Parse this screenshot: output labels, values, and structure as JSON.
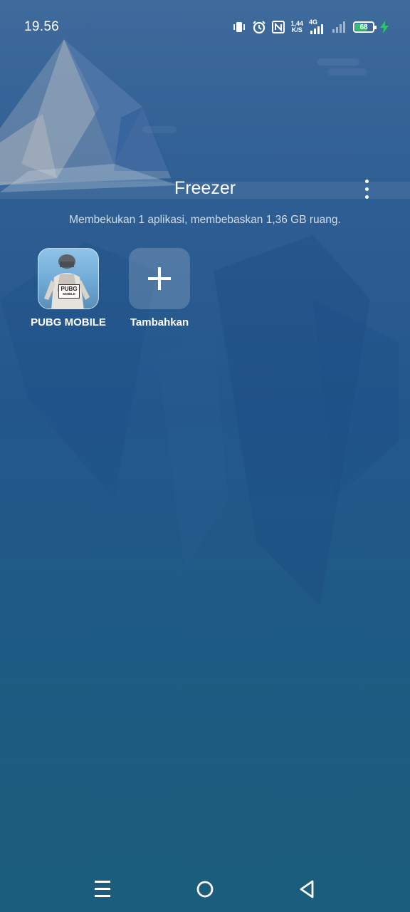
{
  "status_bar": {
    "time": "19.56",
    "net_speed_value": "1,44",
    "net_speed_unit": "K/S",
    "network_type": "4G",
    "battery_level": "68",
    "charging": true,
    "battery_color": "#2ec26b",
    "icons": [
      "vibrate-icon",
      "alarm-icon",
      "nfc-icon",
      "signal-4g-icon",
      "signal-icon",
      "battery-icon",
      "charging-icon"
    ]
  },
  "header": {
    "title": "Freezer",
    "menu_icon": "more-vert-icon"
  },
  "summary": "Membekukan 1 aplikasi, membebaskan 1,36 GB ruang.",
  "apps": [
    {
      "label": "PUBG MOBILE",
      "icon": "pubg-mobile-app-icon",
      "icon_text": "PUBG",
      "icon_subtext": "MOBILE"
    },
    {
      "label": "Tambahkan",
      "icon": "plus-icon"
    }
  ],
  "navigation": {
    "icons": [
      "menu-icon",
      "home-icon",
      "back-icon"
    ]
  }
}
